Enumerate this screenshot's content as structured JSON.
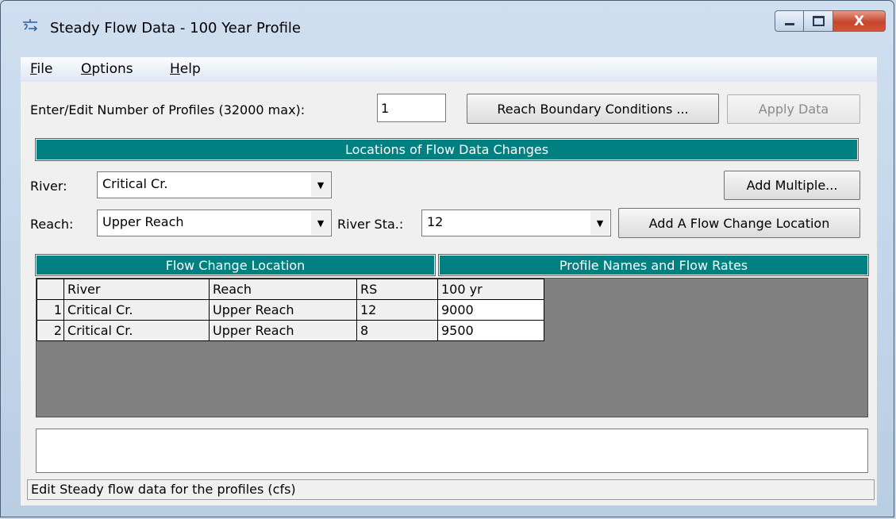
{
  "window": {
    "title": "Steady Flow Data - 100 Year Profile"
  },
  "menu": {
    "file": "File",
    "options": "Options",
    "help": "Help",
    "file_rest": "ile",
    "options_rest": "ptions",
    "help_rest": "elp",
    "file_u": "F",
    "options_u": "O",
    "help_u": "H"
  },
  "profiles": {
    "label": "Enter/Edit Number of Profiles (32000 max):",
    "value": "1"
  },
  "buttons": {
    "reach_boundary": "Reach Boundary Conditions ...",
    "apply_data": "Apply Data",
    "add_multiple": "Add Multiple...",
    "add_flow_change": "Add A Flow Change Location"
  },
  "locations_header": "Locations of Flow Data Changes",
  "river": {
    "label": "River:",
    "value": "Critical Cr."
  },
  "reach": {
    "label": "Reach:",
    "value": "Upper Reach"
  },
  "river_sta": {
    "label": "River Sta.:",
    "value": "12"
  },
  "section_headers": {
    "flow_change": "Flow Change Location",
    "profile_names": "Profile Names and Flow Rates"
  },
  "table": {
    "columns": [
      "River",
      "Reach",
      "RS",
      "100 yr"
    ],
    "rows": [
      {
        "num": "1",
        "river": "Critical Cr.",
        "reach": "Upper Reach",
        "rs": "12",
        "flow": "9000"
      },
      {
        "num": "2",
        "river": "Critical Cr.",
        "reach": "Upper Reach",
        "rs": "8",
        "flow": "9500"
      }
    ]
  },
  "status_text": "Edit Steady flow data for the profiles (cfs)"
}
